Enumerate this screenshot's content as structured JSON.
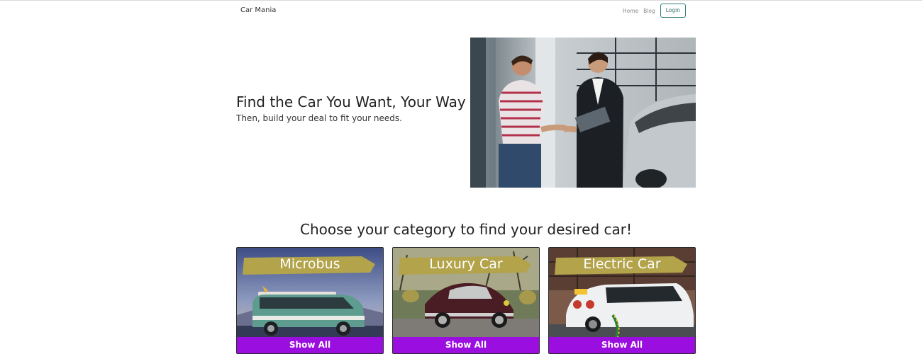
{
  "nav": {
    "brand": "Car Mania",
    "links": [
      "Home",
      "Blog"
    ],
    "login": "Login"
  },
  "hero": {
    "title": "Find the Car You Want, Your Way",
    "subtitle": "Then, build your deal to fit your needs."
  },
  "categories": {
    "title": "Choose your category to find your desired car!",
    "items": [
      {
        "name": "Microbus",
        "button": "Show All"
      },
      {
        "name": "Luxury Car",
        "button": "Show All"
      },
      {
        "name": "Electric Car",
        "button": "Show All"
      }
    ]
  },
  "colors": {
    "accent_purple": "#9b0ee0",
    "banner_gold": "#b3a34a",
    "login_border": "#2e7d77"
  }
}
